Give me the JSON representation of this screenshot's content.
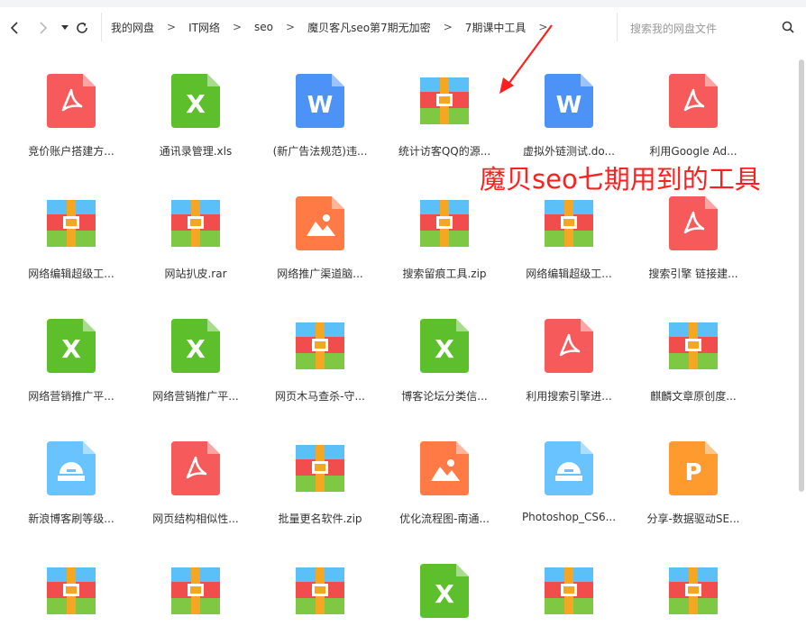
{
  "breadcrumb": [
    "我的网盘",
    "IT网络",
    "seo",
    "魔贝客凡seo第7期无加密",
    "7期课中工具"
  ],
  "breadcrumb_separator": ">",
  "search": {
    "placeholder": "搜索我的网盘文件"
  },
  "annotation": {
    "text": "魔贝seo七期用到的工具",
    "color": "#ff1f1f"
  },
  "icon_colors": {
    "pdf": "#f65a5a",
    "xls": "#5dbf2c",
    "doc": "#4c92f7",
    "img": "#ff7a45",
    "ppt": "#ff9a2e",
    "iso": "#69c3ff"
  },
  "files": [
    {
      "type": "pdf",
      "name": "竞价账户搭建方..."
    },
    {
      "type": "xls",
      "name": "通讯录管理.xls"
    },
    {
      "type": "doc",
      "name": "(新广告法规范)违..."
    },
    {
      "type": "zip",
      "name": "统计访客QQ的源..."
    },
    {
      "type": "doc",
      "name": "虚拟外链测试.do..."
    },
    {
      "type": "pdf",
      "name": "利用Google Ad..."
    },
    {
      "type": "zip",
      "name": "网络编辑超级工..."
    },
    {
      "type": "zip",
      "name": "网站扒皮.rar"
    },
    {
      "type": "img",
      "name": "网络推广渠道脑..."
    },
    {
      "type": "zip",
      "name": "搜索留痕工具.zip"
    },
    {
      "type": "zip",
      "name": "网络编辑超级工..."
    },
    {
      "type": "pdf",
      "name": "搜索引擎 链接建..."
    },
    {
      "type": "xls",
      "name": "网络营销推广平..."
    },
    {
      "type": "xls",
      "name": "网络营销推广平..."
    },
    {
      "type": "zip",
      "name": "网页木马查杀-守..."
    },
    {
      "type": "xls",
      "name": "博客论坛分类信..."
    },
    {
      "type": "pdf",
      "name": "利用搜索引擎进..."
    },
    {
      "type": "zip",
      "name": "麒麟文章原创度..."
    },
    {
      "type": "iso",
      "name": "新浪博客刷等级..."
    },
    {
      "type": "pdf",
      "name": "网页结构相似性..."
    },
    {
      "type": "zip",
      "name": "批量更名软件.zip"
    },
    {
      "type": "img",
      "name": "优化流程图-南通..."
    },
    {
      "type": "iso",
      "name": "Photoshop_CS6..."
    },
    {
      "type": "ppt",
      "name": "分享-数据驱动SE..."
    },
    {
      "type": "zip",
      "name": ""
    },
    {
      "type": "zip",
      "name": ""
    },
    {
      "type": "zip",
      "name": ""
    },
    {
      "type": "xls",
      "name": ""
    },
    {
      "type": "zip",
      "name": ""
    },
    {
      "type": "zip",
      "name": ""
    }
  ]
}
